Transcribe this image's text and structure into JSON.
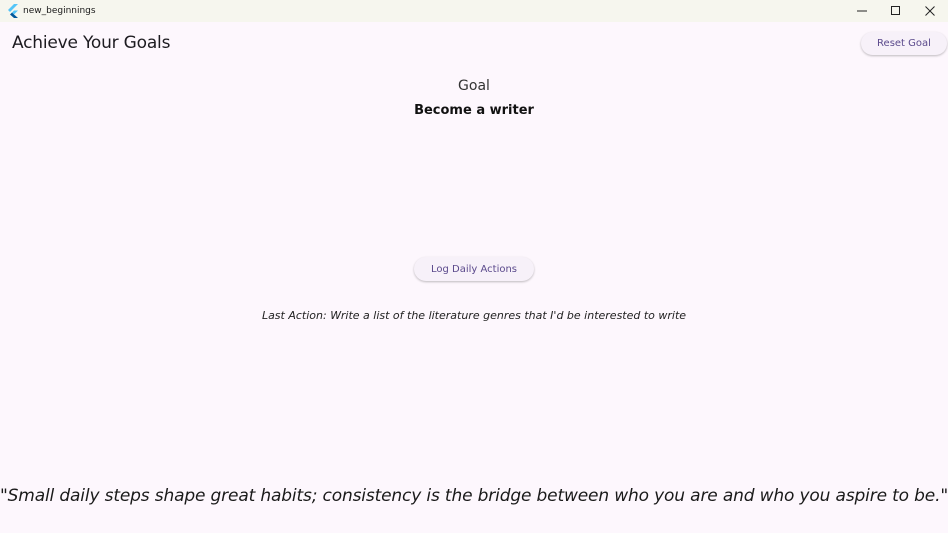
{
  "window": {
    "title": "new_beginnings",
    "icon": "flutter-logo-icon",
    "controls": [
      "minimize-icon",
      "maximize-icon",
      "close-icon"
    ]
  },
  "appbar": {
    "title": "Achieve Your Goals",
    "reset_label": "Reset Goal"
  },
  "goal": {
    "label": "Goal",
    "value": "Become a writer"
  },
  "actions": {
    "log_label": "Log Daily Actions",
    "last_action": "Last Action: Write a list of the literature genres that I'd be interested to write"
  },
  "quote": {
    "text": "\"Small daily steps shape great habits; consistency is the bridge between who you are and who you aspire to be.\""
  },
  "colors": {
    "background": "#fdf7fd",
    "titlebar": "#f6f6ee",
    "button_text": "#5b4a8c",
    "button_bg": "#f7f1f9",
    "flutter_light": "#54c5f8",
    "flutter_dark": "#01579b"
  }
}
